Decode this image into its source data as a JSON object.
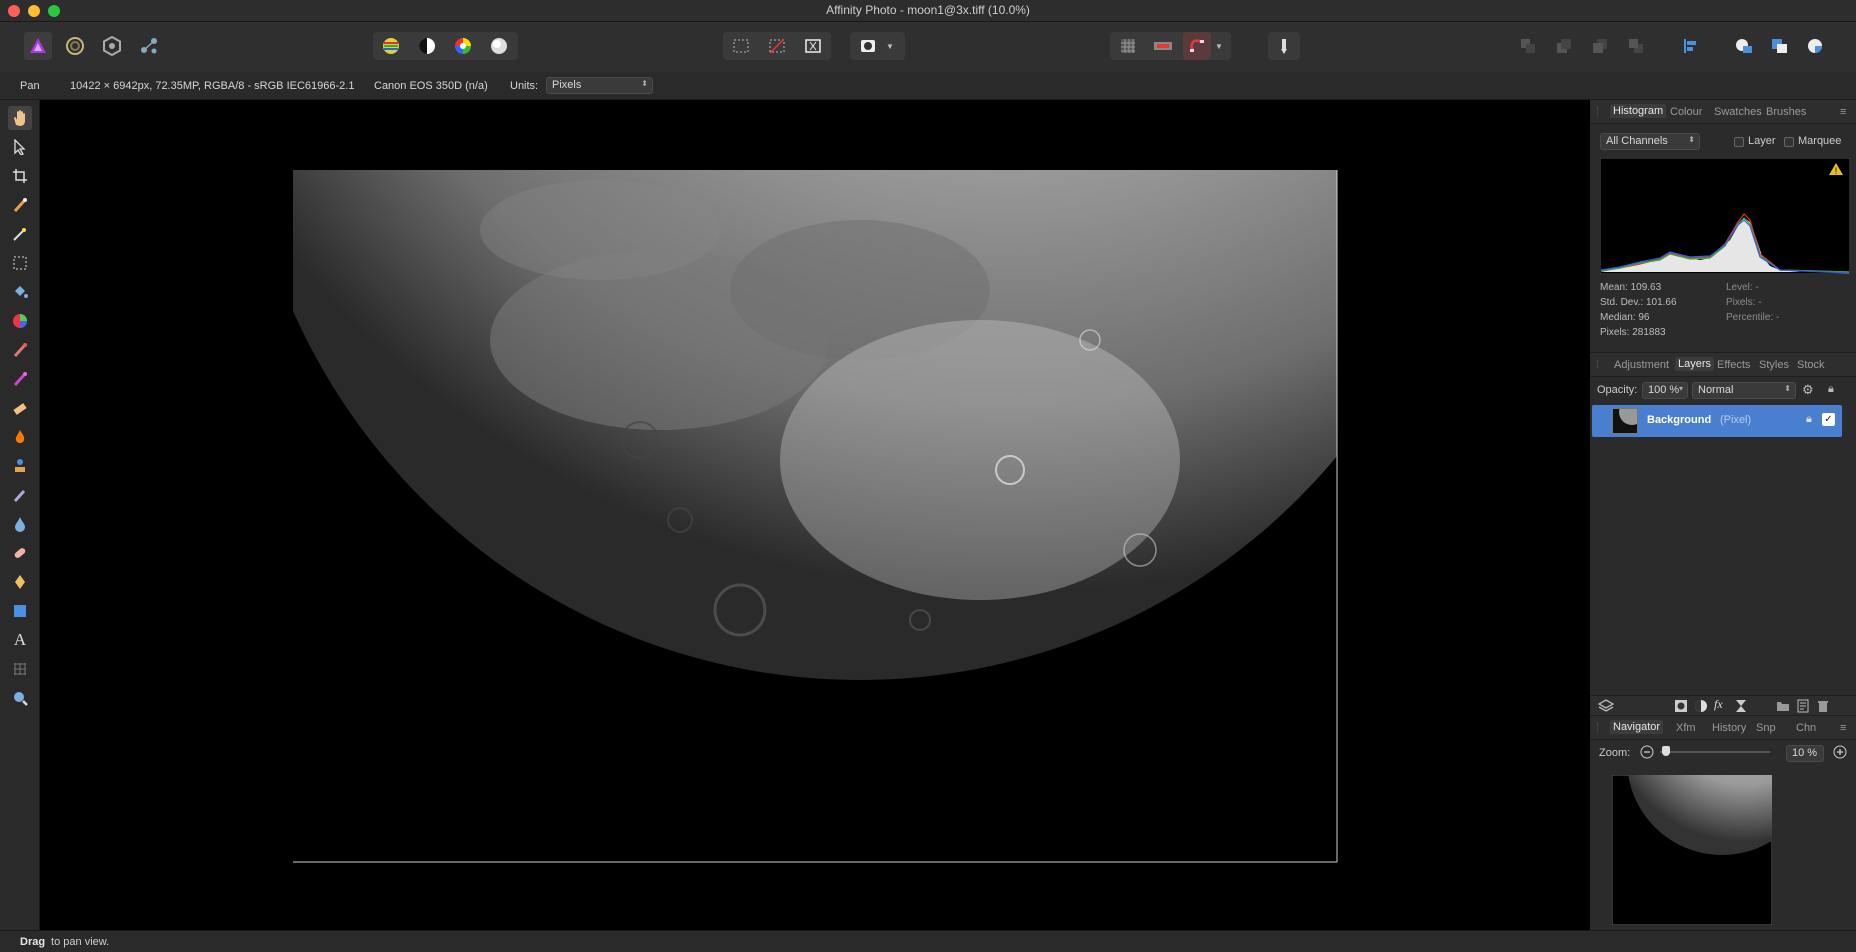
{
  "window": {
    "title": "Affinity Photo - moon1@3x.tiff (10.0%)"
  },
  "context": {
    "tool": "Pan",
    "doc_info": "10422 × 6942px, 72.35MP, RGBA/8 - sRGB IEC61966-2.1",
    "camera": "Canon EOS 350D (n/a)",
    "units_label": "Units:",
    "units_value": "Pixels"
  },
  "histogram_panel": {
    "tabs": [
      "Histogram",
      "Colour",
      "Swatches",
      "Brushes"
    ],
    "channel": "All Channels",
    "layer_label": "Layer",
    "marquee_label": "Marquee",
    "stats": {
      "mean": "Mean: 109.63",
      "stddev": "Std. Dev.: 101.66",
      "median": "Median: 96",
      "pixels": "Pixels: 281883",
      "level": "Level: -",
      "pixels_right": "Pixels: -",
      "percentile": "Percentile: -"
    }
  },
  "layers_panel": {
    "tabs": [
      "Adjustment",
      "Layers",
      "Effects",
      "Styles",
      "Stock"
    ],
    "opacity_label": "Opacity:",
    "opacity_value": "100 %",
    "blend_mode": "Normal",
    "layer_name": "Background",
    "layer_type": "(Pixel)"
  },
  "navigator_panel": {
    "tabs": [
      "Navigator",
      "Xfm",
      "History",
      "Snp",
      "Chn"
    ],
    "zoom_label": "Zoom:",
    "zoom_value": "10 %"
  },
  "status": {
    "bold": "Drag",
    "text": " to pan view."
  },
  "colors": {
    "accent_selection": "#4a7fcf",
    "panel_bg": "#2b2b2b",
    "canvas_bg": "#000000"
  }
}
